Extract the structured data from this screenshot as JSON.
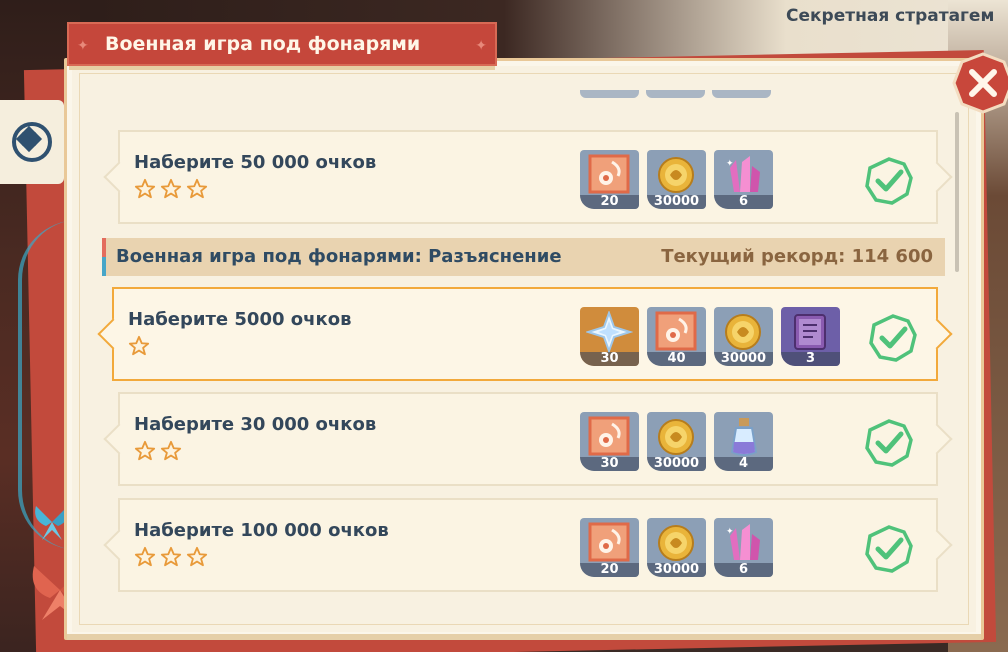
{
  "header": {
    "title": "Военная игра под фонарями",
    "secret_title": "Секретная стратагем"
  },
  "colors": {
    "panel_bg": "#f8f1e1",
    "title_tab": "#c5473b",
    "selected_border": "#f2a93b",
    "check_green": "#4fc27a",
    "star_orange": "#e89a3a",
    "close_red": "#c8473b"
  },
  "section": {
    "title": "Военная игра под фонарями: Разъяснение",
    "record": "Текущий рекорд: 114 600"
  },
  "top_card": {
    "title": "Наберите 50 000 очков",
    "stars": 3,
    "rewards": [
      {
        "icon": "exp-book-icon",
        "count": "20"
      },
      {
        "icon": "mora-coin-icon",
        "count": "30000"
      },
      {
        "icon": "crystal-icon",
        "count": "6"
      }
    ],
    "completed": true
  },
  "missions": [
    {
      "title": "Наберите 5000 очков",
      "stars": 1,
      "selected": true,
      "rewards": [
        {
          "icon": "primogem-icon",
          "count": "30"
        },
        {
          "icon": "exp-book-icon",
          "count": "40"
        },
        {
          "icon": "mora-coin-icon",
          "count": "30000"
        },
        {
          "icon": "purple-book-icon",
          "count": "3"
        }
      ],
      "completed": true
    },
    {
      "title": "Наберите 30 000 очков",
      "stars": 2,
      "selected": false,
      "rewards": [
        {
          "icon": "exp-book-icon",
          "count": "30"
        },
        {
          "icon": "mora-coin-icon",
          "count": "30000"
        },
        {
          "icon": "potion-icon",
          "count": "4"
        }
      ],
      "completed": true
    },
    {
      "title": "Наберите 100 000 очков",
      "stars": 3,
      "selected": false,
      "rewards": [
        {
          "icon": "exp-book-icon",
          "count": "20"
        },
        {
          "icon": "mora-coin-icon",
          "count": "30000"
        },
        {
          "icon": "crystal-icon",
          "count": "6"
        }
      ],
      "completed": true
    }
  ]
}
